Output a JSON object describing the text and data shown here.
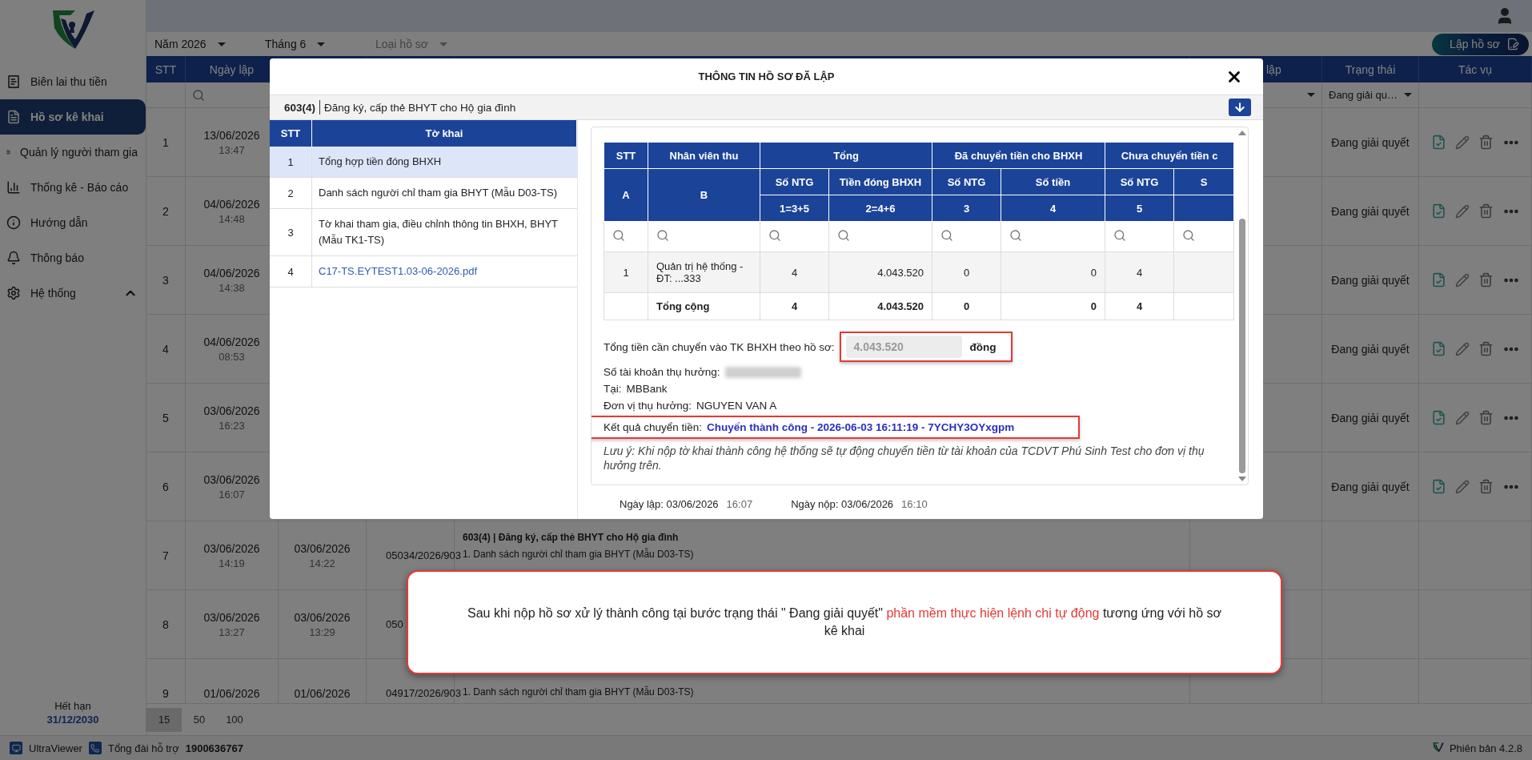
{
  "sidebar": {
    "items": [
      {
        "label": "Biên lai thu tiền",
        "selected": false
      },
      {
        "label": "Hồ sơ kê khai",
        "selected": true
      },
      {
        "label": "Quản lý người tham gia",
        "selected": false
      },
      {
        "label": "Thống kê - Báo cáo",
        "selected": false
      },
      {
        "label": "Hướng dẫn",
        "selected": false
      },
      {
        "label": "Thông báo",
        "selected": false
      },
      {
        "label": "Hệ thống",
        "selected": false,
        "expanded": true
      }
    ],
    "expiry_label": "Hết hạn",
    "expiry_date": "31/12/2030"
  },
  "filters": [
    {
      "value": "Năm 2026"
    },
    {
      "value": "Tháng 6"
    },
    {
      "placeholder": "Loại hồ sơ"
    }
  ],
  "create_button": {
    "label": "Lập hồ sơ"
  },
  "table": {
    "header": [
      {
        "label": "STT"
      },
      {
        "label": "Ngày lập"
      },
      {
        "label": "lập"
      },
      {
        "label": "Trạng thái"
      },
      {
        "label": "Tác vụ"
      }
    ],
    "status_filter": {
      "value": "Đang giải qu…"
    },
    "rows": [
      {
        "stt": "1",
        "created": {
          "date": "13/06/2026",
          "time": "13:47"
        },
        "status": "Đang giải quyết"
      },
      {
        "stt": "2",
        "created": {
          "date": "04/06/2026",
          "time": "14:48"
        },
        "status": "Đang giải quyết"
      },
      {
        "stt": "3",
        "created": {
          "date": "04/06/2026",
          "time": "14:38"
        },
        "status": "Đang giải quyết"
      },
      {
        "stt": "4",
        "created": {
          "date": "04/06/2026",
          "time": "08:53"
        },
        "status": "Đang giải quyết"
      },
      {
        "stt": "5",
        "created": {
          "date": "03/06/2026",
          "time": "16:23"
        },
        "status": "Đang giải quyết"
      },
      {
        "stt": "6",
        "created": {
          "date": "03/06/2026",
          "time": "16:07"
        },
        "status": "Đang giải quyết"
      },
      {
        "stt": "7",
        "created": {
          "date": "03/06/2026",
          "time": "14:19"
        },
        "column_3": {
          "date": "03/06/2026",
          "time": "14:22"
        },
        "code": "05034/2026/903",
        "title": "603(4) | Đăng ký, cấp thẻ BHYT cho Hộ gia đình",
        "lines": [
          "1. Danh sách người chỉ tham gia BHYT (Mẫu D03-TS)"
        ]
      },
      {
        "stt": "8",
        "created": {
          "date": "03/06/2026",
          "time": "13:27"
        },
        "column_3": {
          "date": "03/06/2026",
          "time": "13:29"
        },
        "code": "050"
      },
      {
        "stt": "9",
        "created": {
          "date": "01/06/2026"
        },
        "column_3": {
          "date": "01/06/2026"
        },
        "code": "04917/2026/903",
        "lines": [
          "1. Danh sách người chỉ tham gia BHYT (Mẫu D03-TS)"
        ]
      }
    ]
  },
  "pagination": [
    {
      "label": "15",
      "selected": true
    },
    {
      "label": "50",
      "selected": false
    },
    {
      "label": "100",
      "selected": false
    }
  ],
  "footer": {
    "remote_app": "UltraViewer",
    "hotline_label": "Tổng đài hỗ trợ",
    "hotline": "1900636767",
    "version": "Phiên bản 4.2.8"
  },
  "modal": {
    "title": "THÔNG TIN HỒ SƠ ĐÃ LẬP",
    "code": "603(4)",
    "name": "Đăng ký, cấp thẻ BHYT cho Hộ gia đình",
    "forms": {
      "columns": [
        "STT",
        "Tờ khai"
      ],
      "rows": [
        {
          "stt": "1",
          "name": "Tổng hợp tiền đóng BHXH",
          "kind": "text",
          "selected": true
        },
        {
          "stt": "2",
          "name": "Danh sách người chỉ tham gia BHYT (Mẫu D03-TS)",
          "kind": "text",
          "selected": false
        },
        {
          "stt": "3",
          "name": "Tờ khai tham gia, điều chỉnh thông tin BHXH, BHYT (Mẫu TK1-TS)",
          "kind": "text",
          "selected": false
        },
        {
          "stt": "4",
          "name": "C17-TS.EYTEST1.03-06-2026.pdf",
          "kind": "file",
          "selected": false
        }
      ]
    },
    "summary_table": {
      "lead_columns": [
        {
          "label": "STT",
          "letter": "A"
        },
        {
          "label": "Nhân viên thu",
          "letter": "B"
        }
      ],
      "groups": [
        {
          "label": "Tổng",
          "columns": [
            {
              "label": "Số NTG",
              "formula": "1=3+5"
            },
            {
              "label": "Tiền đóng BHXH",
              "formula": "2=4+6"
            }
          ]
        },
        {
          "label": "Đã chuyển tiền cho BHXH",
          "columns": [
            {
              "label": "Số NTG",
              "formula": "3"
            },
            {
              "label": "Số tiền",
              "formula": "4"
            }
          ]
        },
        {
          "label": "Chưa chuyển tiền c",
          "columns": [
            {
              "label": "Số NTG",
              "formula": "5"
            },
            {
              "label": "S"
            }
          ]
        }
      ],
      "rows": [
        {
          "stt": "1",
          "collector": "Quản trị hệ thống - ĐT: ...333",
          "values": [
            "4",
            "4.043.520",
            "0",
            "0",
            "4"
          ]
        }
      ],
      "total": {
        "label": "Tổng cộng",
        "values": [
          "4",
          "4.043.520",
          "0",
          "0",
          "4"
        ]
      }
    },
    "transfer_total": {
      "label": "Tổng tiền cần chuyển vào TK BHXH theo hồ sơ:",
      "value": "4.043.520",
      "unit": "đồng",
      "disabled": true,
      "highlighted": true
    },
    "account": {
      "label": "Số tài khoản thụ hưởng:"
    },
    "bank": {
      "label": "Tại:",
      "value": "MBBank"
    },
    "beneficiary": {
      "label": "Đơn vị thụ hưởng:",
      "value": "NGUYEN VAN A"
    },
    "result": {
      "label": "Kết quả chuyển tiền:",
      "value": "Chuyển thành công - 2026-06-03 16:11:19 - 7YCHY3OYxgpm",
      "highlighted": true
    },
    "note": "Lưu ý: Khi nộp tờ khai thành công hệ thống sẽ tự động chuyển tiền từ tài khoản của TCDVT Phú Sinh Test cho đơn vị thụ hưởng trên.",
    "dates": [
      {
        "label": "Ngày lập: 03/06/2026",
        "time": "16:07"
      },
      {
        "label": "Ngày nộp: 03/06/2026",
        "time": "16:10"
      }
    ]
  },
  "callout": {
    "before": "Sau khi nộp hồ sơ xử lý thành công tại bước trạng thái \" Đang giải quyết\" ",
    "highlight": "phần mềm thực hiện lệnh chi tự động",
    "after": "  tương ứng với hồ sơ kê khai"
  }
}
